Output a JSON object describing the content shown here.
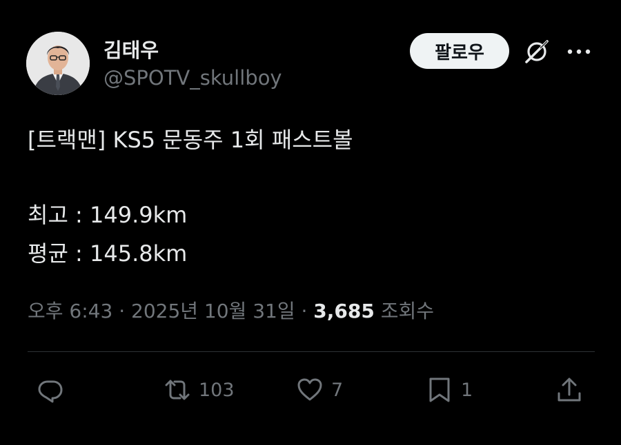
{
  "author": {
    "name": "김태우",
    "handle": "@SPOTV_skullboy"
  },
  "header": {
    "follow_label": "팔로우",
    "icons": [
      "grok-icon",
      "more-icon"
    ]
  },
  "tweet": {
    "line1": "[트랙맨] KS5 문동주 1회 패스트볼",
    "line2": "최고 : 149.9km",
    "line3": "평균 : 145.8km"
  },
  "meta": {
    "timestamp": "오후 6:43 · 2025년 10월 31일 · ",
    "views_count": "3,685",
    "views_label": " 조회수"
  },
  "actions": {
    "reply_count": "",
    "retweet_count": "103",
    "like_count": "7",
    "bookmark_count": "1",
    "icons": [
      "reply-icon",
      "retweet-icon",
      "heart-icon",
      "bookmark-icon",
      "share-icon"
    ]
  },
  "colors": {
    "background": "#000000",
    "text_primary": "#e7e9ea",
    "text_secondary": "#71767b",
    "follow_button_bg": "#eff3f4",
    "divider": "#2f3336"
  }
}
